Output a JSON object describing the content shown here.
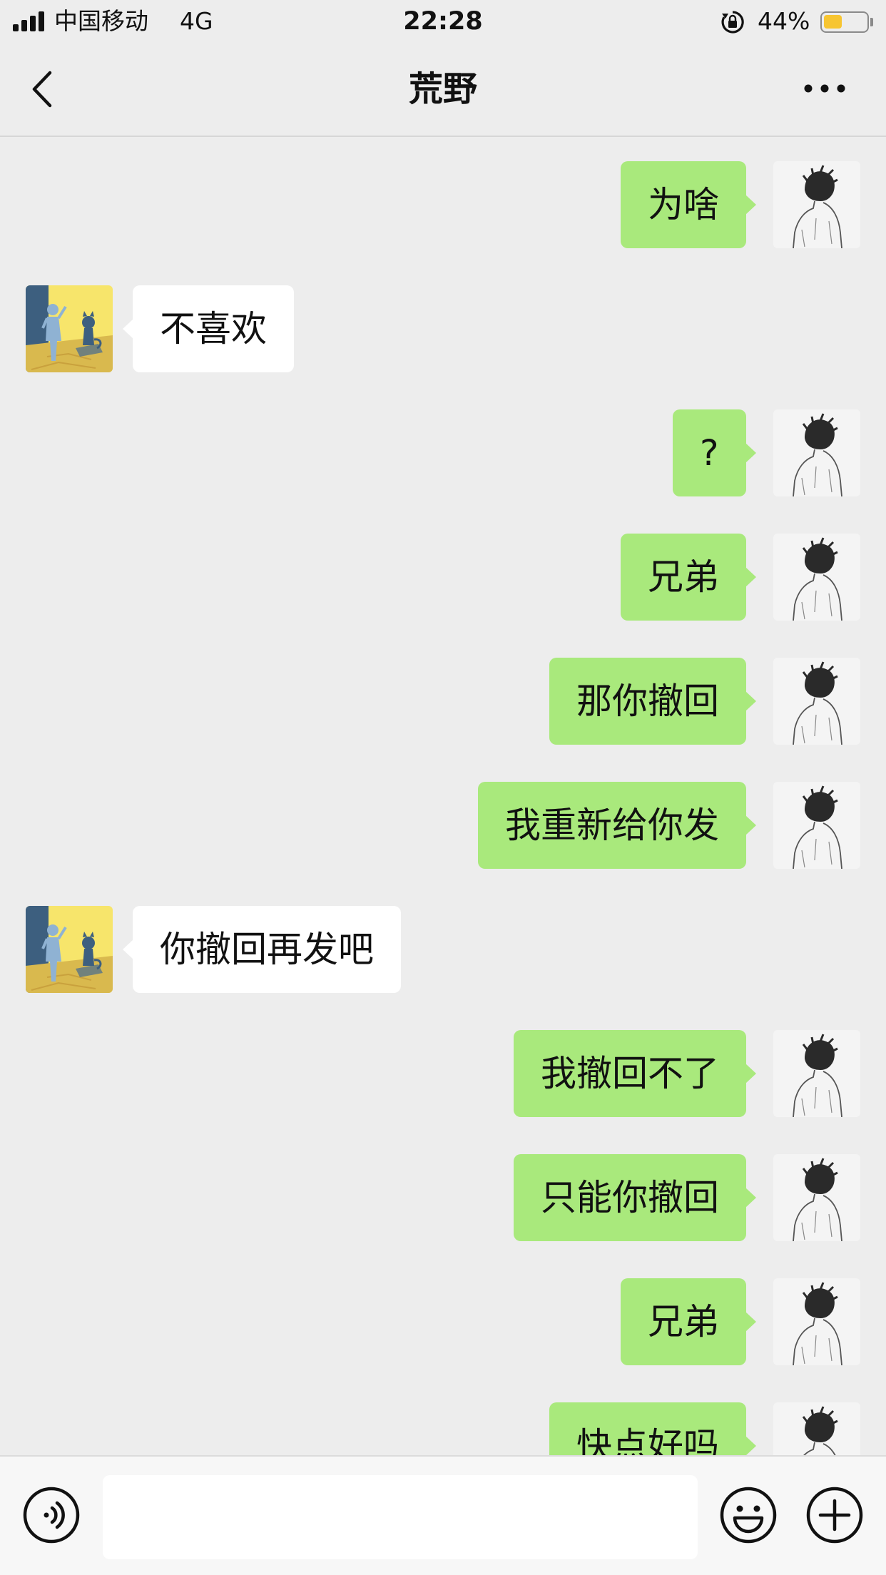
{
  "status_bar": {
    "carrier": "中国移动",
    "network": "4G",
    "time": "22:28",
    "battery_percent_label": "44%",
    "battery_level": 0.44,
    "signal_bars": 4,
    "icons": [
      "signal-icon",
      "rotation-lock-icon",
      "battery-icon"
    ]
  },
  "nav": {
    "title": "荒野",
    "icons": [
      "back-arrow-icon",
      "more-options-icon"
    ]
  },
  "messages": [
    {
      "side": "mine",
      "text": "为啥"
    },
    {
      "side": "theirs",
      "text": "不喜欢"
    },
    {
      "side": "mine",
      "text": "?"
    },
    {
      "side": "mine",
      "text": "兄弟"
    },
    {
      "side": "mine",
      "text": "那你撤回"
    },
    {
      "side": "mine",
      "text": "我重新给你发"
    },
    {
      "side": "theirs",
      "text": "你撤回再发吧"
    },
    {
      "side": "mine",
      "text": "我撤回不了"
    },
    {
      "side": "mine",
      "text": "只能你撤回"
    },
    {
      "side": "mine",
      "text": "兄弟"
    },
    {
      "side": "mine",
      "text": "快点好吗"
    }
  ],
  "input_bar": {
    "message_value": "",
    "icons": [
      "voice-icon",
      "emoji-icon",
      "plus-icon"
    ]
  },
  "colors": {
    "background": "#ededed",
    "my_bubble": "#a9e97c",
    "their_bubble": "#ffffff",
    "battery_fill": "#f7c531",
    "input_bar": "#f7f7f7"
  }
}
